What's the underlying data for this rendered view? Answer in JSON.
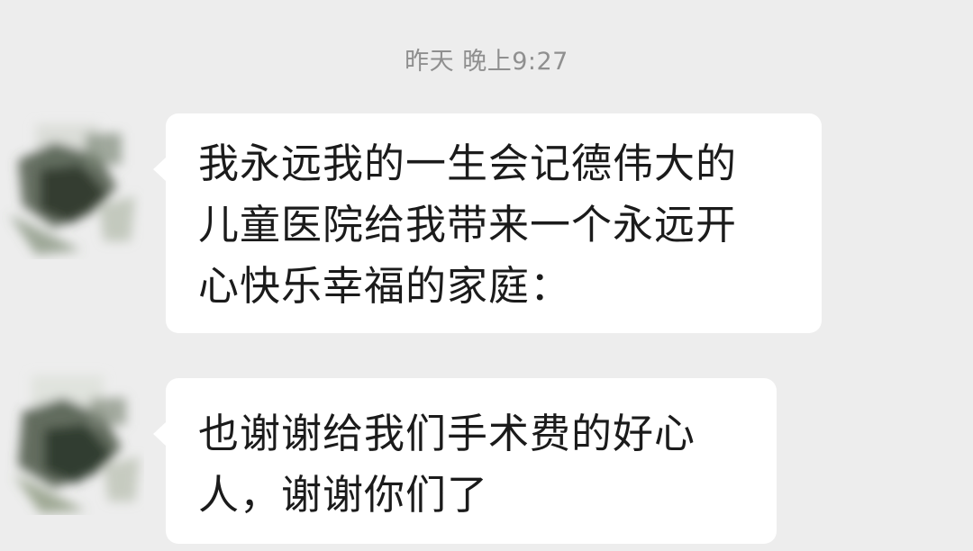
{
  "chat": {
    "timestamp": "昨天 晚上9:27",
    "messages": [
      {
        "lines": [
          "我永远我的一生会记德伟大的",
          "儿童医院给我带来一个永远开",
          "心快乐幸福的家庭："
        ]
      },
      {
        "lines": [
          "也谢谢给我们手术费的好心",
          "人，谢谢你们了"
        ]
      }
    ]
  },
  "colors": {
    "background": "#ededed",
    "bubble": "#ffffff",
    "timestamp_text": "#8f8f8f",
    "message_text": "#1b1b1b"
  },
  "icons": {
    "avatar": "blurred-avatar-icon"
  }
}
